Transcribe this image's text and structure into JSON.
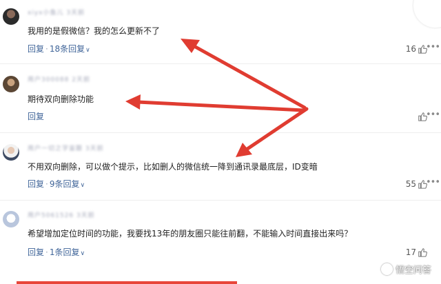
{
  "comments": [
    {
      "username": "xiyx小鱼儿 3天前",
      "text": "我用的是假微信？我的怎么更新不了",
      "reply_label": "回复",
      "replies_label": "18条回复",
      "likes": "16"
    },
    {
      "username": "用户300088 2天前",
      "text": "期待双向删除功能",
      "reply_label": "回复",
      "replies_label": "",
      "likes": ""
    },
    {
      "username": "用户一切之字宙跟 3天前",
      "text": "不用双向删除，可以做个提示，比如删人的微信统一降到通讯录最底层，ID变暗",
      "reply_label": "回复",
      "replies_label": "9条回复",
      "likes": "55"
    },
    {
      "username": "用户5061526 3天前",
      "text": "希望增加定位时间的功能，我要找13年的朋友圈只能往前翻，不能输入时间直接出来吗？",
      "reply_label": "回复",
      "replies_label": "1条回复",
      "likes": "17"
    }
  ],
  "icons": {
    "like": "thumbs-up-icon",
    "more": "more-options-icon",
    "expand": "chevron-down-icon",
    "watermark": "wukong-logo-icon"
  },
  "colors": {
    "link": "#406599",
    "arrow": "#e03c31"
  },
  "watermark": {
    "text": "悟空问答"
  }
}
